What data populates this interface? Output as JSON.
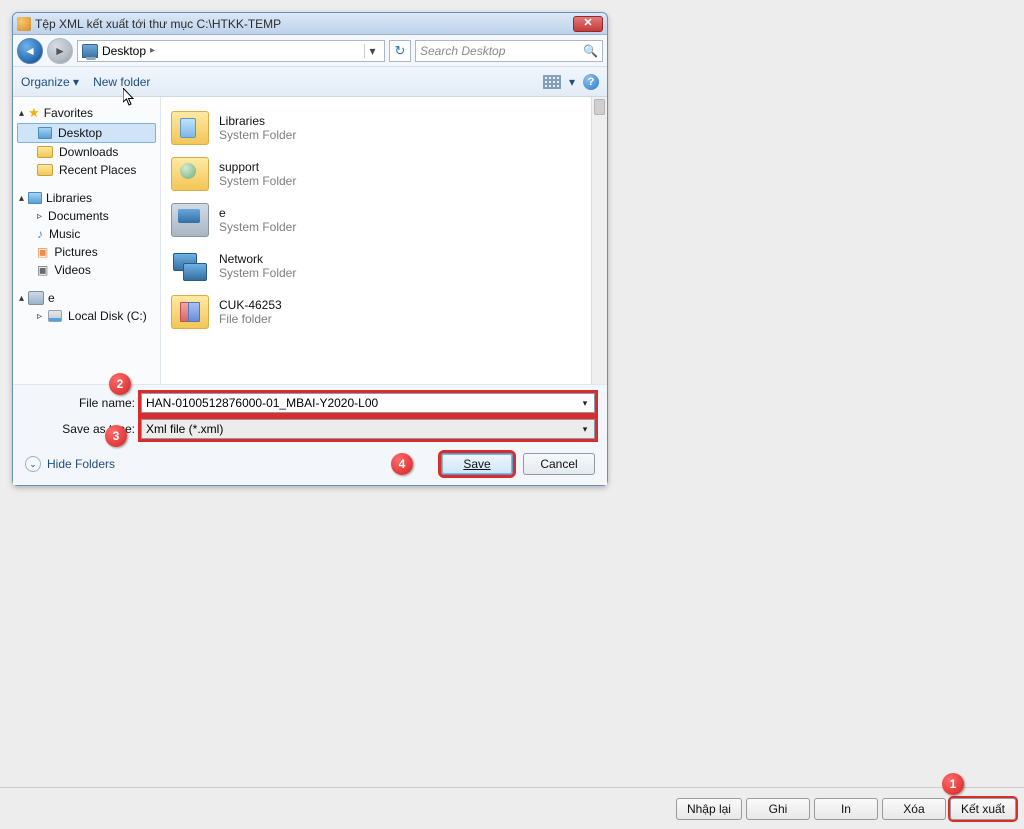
{
  "dialog": {
    "title": "Tệp XML kết xuất tới thư mục C:\\HTKK-TEMP",
    "close": "✕"
  },
  "nav": {
    "location": "Desktop",
    "search_placeholder": "Search Desktop",
    "back_glyph": "◄",
    "fwd_glyph": "►",
    "chevron": "▸",
    "dropdown": "▾",
    "refresh": "↻",
    "search_icon": "🔍"
  },
  "toolbar": {
    "organize": "Organize ▾",
    "newfolder": "New folder",
    "view_drop": "▾",
    "help": "?"
  },
  "sidebar": {
    "favorites": {
      "label": "Favorites",
      "items": [
        "Desktop",
        "Downloads",
        "Recent Places"
      ]
    },
    "libraries": {
      "label": "Libraries",
      "items": [
        "Documents",
        "Music",
        "Pictures",
        "Videos"
      ]
    },
    "computer": {
      "label": "e",
      "items": [
        "Local Disk (C:)"
      ]
    }
  },
  "files": [
    {
      "name": "Libraries",
      "sub": "System Folder",
      "iconCls": "bigfold lib"
    },
    {
      "name": "support",
      "sub": "System Folder",
      "iconCls": "bigfold support"
    },
    {
      "name": "e",
      "sub": "System Folder",
      "iconCls": "monbig scr"
    },
    {
      "name": "Network",
      "sub": "System Folder",
      "iconCls": "netbig"
    },
    {
      "name": "CUK-46253",
      "sub": "File folder",
      "iconCls": "bigfold files"
    }
  ],
  "inputs": {
    "filename_label": "File name:",
    "filename_value": "HAN-0100512876000-01_MBAI-Y2020-L00",
    "type_label": "Save as type:",
    "type_value": "Xml file (*.xml)",
    "dropdown": "▾"
  },
  "buttons": {
    "hide_folders": "Hide Folders",
    "hide_arrow": "⌄",
    "save": "Save",
    "cancel": "Cancel"
  },
  "footer": {
    "btns": [
      "Nhập lại",
      "Ghi",
      "In",
      "Xóa",
      "Kết xuất"
    ]
  },
  "annotations": {
    "b1": "1",
    "b2": "2",
    "b3": "3",
    "b4": "4"
  }
}
